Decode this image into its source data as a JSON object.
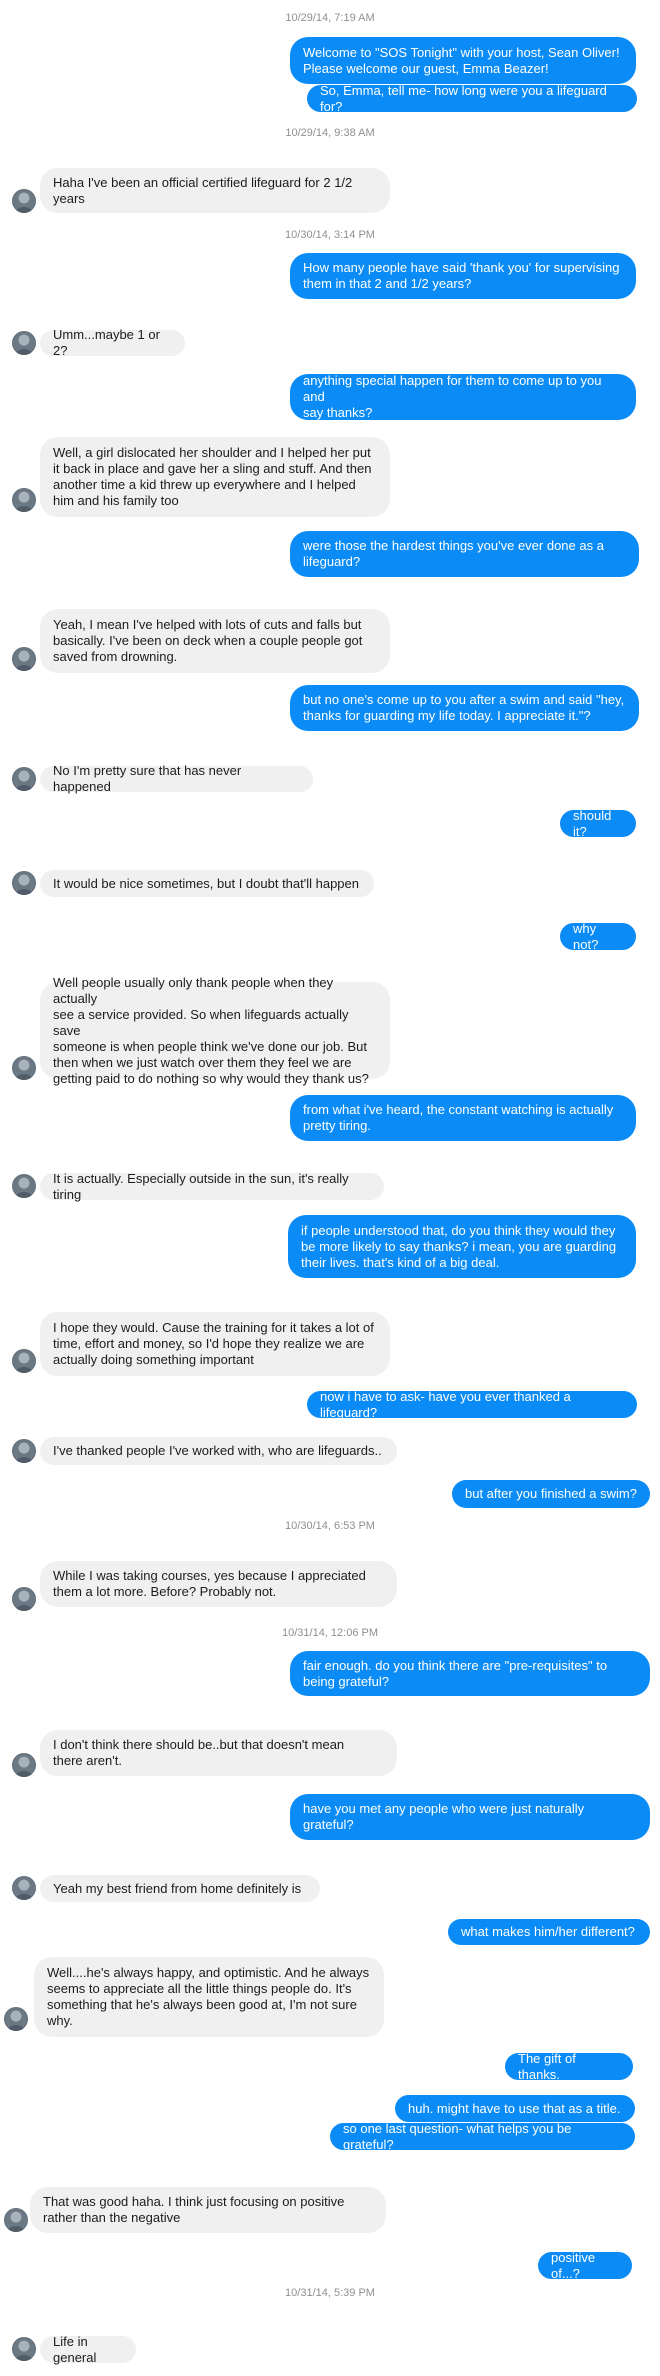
{
  "conversation": {
    "timestamps": [
      "10/29/14, 7:19 AM",
      "10/29/14, 9:38 AM",
      "10/30/14, 3:14 PM",
      "10/30/14, 6:53 PM",
      "10/31/14, 12:06 PM",
      "10/31/14, 5:39 PM"
    ],
    "messages": [
      {
        "sender": "host",
        "text": "Welcome to \"SOS Tonight\" with your host, Sean Oliver!\nPlease welcome our guest, Emma Beazer!"
      },
      {
        "sender": "host",
        "text": "So, Emma, tell me- how long were you a lifeguard for?"
      },
      {
        "sender": "guest",
        "text": "Haha I've been an official certified lifeguard for 2 1/2\nyears"
      },
      {
        "sender": "host",
        "text": "How many people have said 'thank you' for supervising\nthem in that 2 and 1/2 years?"
      },
      {
        "sender": "guest",
        "text": "Umm...maybe 1 or 2?"
      },
      {
        "sender": "host",
        "text": "anything special happen for them to come up to you and\nsay thanks?"
      },
      {
        "sender": "guest",
        "text": "Well, a girl dislocated her shoulder and I helped her put\nit back in place and gave her a sling and stuff. And then\nanother time a kid threw up everywhere and I helped\nhim and his family too"
      },
      {
        "sender": "host",
        "text": "were those the hardest things you've ever done as a\nlifeguard?"
      },
      {
        "sender": "guest",
        "text": "Yeah, I mean I've helped with lots of cuts and falls but\nbasically. I've been on deck when a couple people got\nsaved from drowning."
      },
      {
        "sender": "host",
        "text": "but no one's come up to you after a swim and said \"hey,\nthanks for guarding my life today. I appreciate it.\"?"
      },
      {
        "sender": "guest",
        "text": "No I'm pretty sure that has never happened"
      },
      {
        "sender": "host",
        "text": "should it?"
      },
      {
        "sender": "guest",
        "text": "It would be nice sometimes, but I doubt that'll happen"
      },
      {
        "sender": "host",
        "text": "why not?"
      },
      {
        "sender": "guest",
        "text": "Well people usually only thank people when they actually\nsee a service provided. So when lifeguards actually save\nsomeone is when people think we've done our job. But\nthen when we just watch over them they feel we are\ngetting paid to do nothing so why would they thank us?"
      },
      {
        "sender": "host",
        "text": "from what i've heard, the constant watching is actually\npretty tiring."
      },
      {
        "sender": "guest",
        "text": "It is actually. Especially outside in the sun, it's really tiring"
      },
      {
        "sender": "host",
        "text": "if people understood that, do you think they would they\nbe more likely to say thanks? i mean, you are guarding\ntheir lives. that's kind of a big deal."
      },
      {
        "sender": "guest",
        "text": "I hope they would. Cause the training for it takes a lot of\ntime, effort and money, so I'd hope they realize we are\nactually doing something important"
      },
      {
        "sender": "host",
        "text": "now i have to ask- have you ever thanked a lifeguard?"
      },
      {
        "sender": "guest",
        "text": "I've thanked people I've worked with, who are lifeguards.."
      },
      {
        "sender": "host",
        "text": "but after you finished a swim?"
      },
      {
        "sender": "guest",
        "text": "While I was taking courses, yes because I appreciated\nthem a lot more. Before? Probably not."
      },
      {
        "sender": "host",
        "text": "fair enough. do you think there are \"pre-requisites\" to\nbeing grateful?"
      },
      {
        "sender": "guest",
        "text": "I don't think there should be..but that doesn't mean\nthere aren't."
      },
      {
        "sender": "host",
        "text": "have you met any people who were just naturally\ngrateful?"
      },
      {
        "sender": "guest",
        "text": "Yeah my best friend from home definitely is"
      },
      {
        "sender": "host",
        "text": "what makes him/her different?"
      },
      {
        "sender": "guest",
        "text": "Well....he's always happy, and optimistic. And he always\nseems to appreciate all the little things people do. It's\nsomething that he's always been good at, I'm not sure\nwhy."
      },
      {
        "sender": "host",
        "text": "The gift of thanks."
      },
      {
        "sender": "host",
        "text": "huh. might have to use that as a title."
      },
      {
        "sender": "host",
        "text": "so one last question- what helps you be grateful?"
      },
      {
        "sender": "guest",
        "text": "That was good haha. I think just focusing on positive\nrather than the negative"
      },
      {
        "sender": "host",
        "text": "positive of...?"
      },
      {
        "sender": "guest",
        "text": "Life in general"
      }
    ]
  },
  "colors": {
    "outgoing_bubble": "#0a8bf5",
    "incoming_bubble": "#f0f0f0",
    "timestamp_text": "#8f8f8f"
  },
  "avatar_icon": "user-avatar-icon"
}
